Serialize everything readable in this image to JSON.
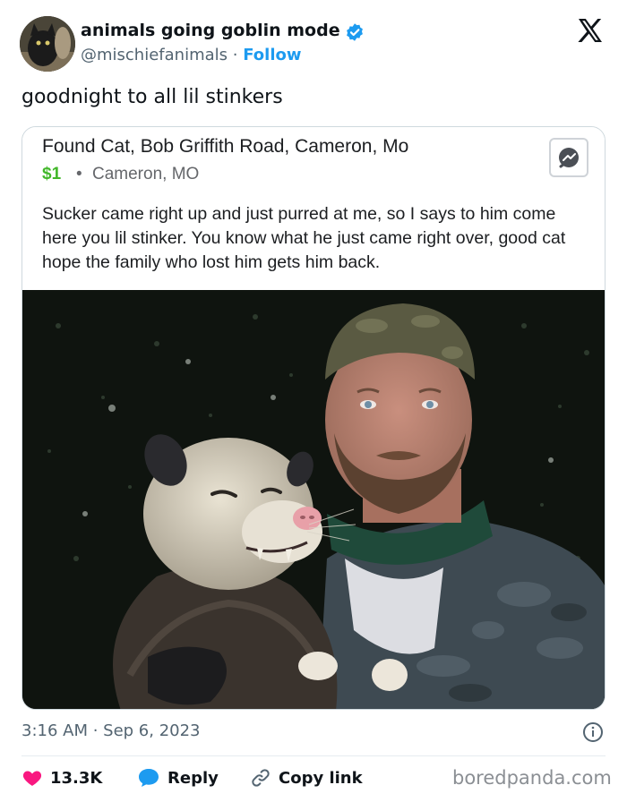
{
  "author": {
    "display_name": "animals going goblin mode",
    "handle": "@mischiefanimals",
    "separator": "·",
    "follow_label": "Follow"
  },
  "tweet": {
    "text": "goodnight to all lil stinkers"
  },
  "embedded_post": {
    "title": "Found Cat, Bob Griffith Road, Cameron, Mo",
    "price": "$1",
    "separator": "•",
    "location": "Cameron, MO",
    "description": "Sucker came right up and just purred at me, so I says to him come here you lil stinker. You know what he just came right over, good cat hope the family who lost him gets him back."
  },
  "meta": {
    "timestamp": "3:16 AM · Sep 6, 2023"
  },
  "actions": {
    "likes_count": "13.3K",
    "reply_label": "Reply",
    "copy_link_label": "Copy link"
  },
  "watermark": "boredpanda.com",
  "icons": {
    "verified": "verified-badge-icon",
    "logo": "x-logo-icon",
    "messenger": "messenger-icon",
    "info": "info-icon",
    "like": "heart-icon",
    "reply": "speech-bubble-icon",
    "copy": "link-icon"
  },
  "colors": {
    "accent": "#1d9bf0",
    "heart": "#f91880",
    "price_green": "#42b72a",
    "secondary_text": "#536471"
  }
}
